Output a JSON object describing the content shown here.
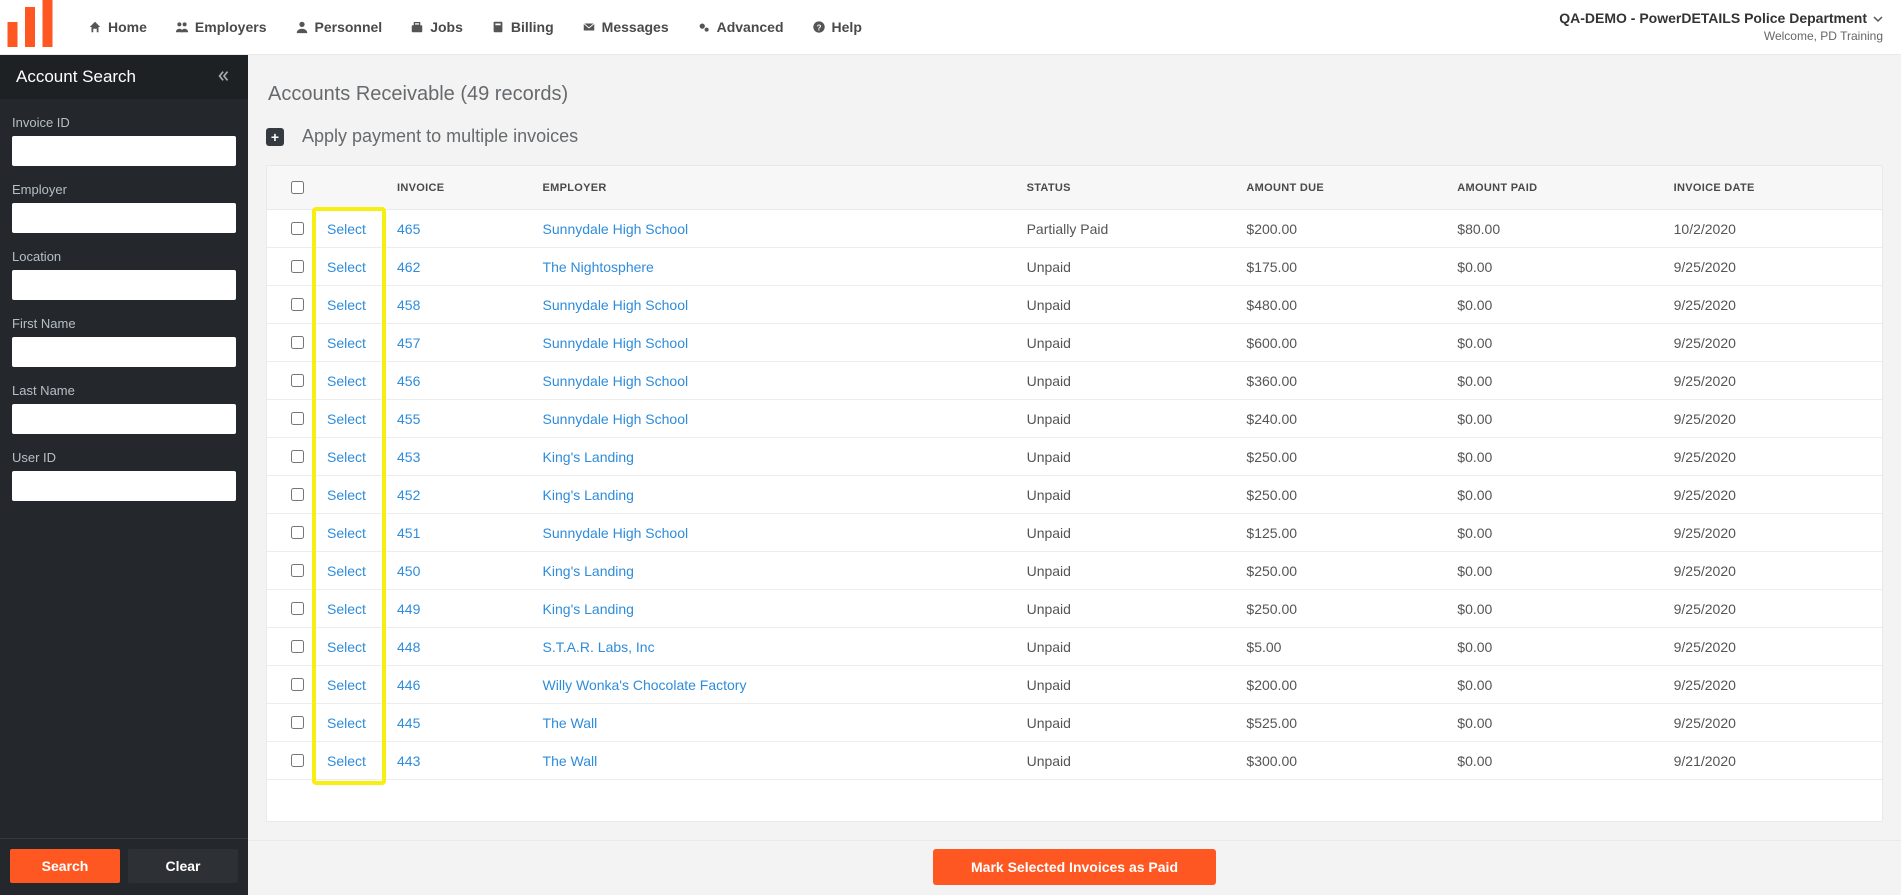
{
  "header": {
    "nav": [
      {
        "label": "Home",
        "icon": "home"
      },
      {
        "label": "Employers",
        "icon": "users"
      },
      {
        "label": "Personnel",
        "icon": "person"
      },
      {
        "label": "Jobs",
        "icon": "briefcase"
      },
      {
        "label": "Billing",
        "icon": "calc"
      },
      {
        "label": "Messages",
        "icon": "envelope"
      },
      {
        "label": "Advanced",
        "icon": "cogs"
      },
      {
        "label": "Help",
        "icon": "question"
      }
    ],
    "org": "QA-DEMO - PowerDETAILS Police Department",
    "welcome": "Welcome, PD Training"
  },
  "sidebar": {
    "title": "Account Search",
    "fields": {
      "invoice_id": {
        "label": "Invoice ID"
      },
      "employer": {
        "label": "Employer"
      },
      "location": {
        "label": "Location"
      },
      "first_name": {
        "label": "First Name"
      },
      "last_name": {
        "label": "Last Name"
      },
      "user_id": {
        "label": "User ID"
      }
    },
    "search_label": "Search",
    "clear_label": "Clear"
  },
  "page": {
    "title": "Accounts Receivable (49 records)",
    "apply_label": "Apply payment to multiple invoices",
    "mark_paid_label": "Mark Selected Invoices as Paid"
  },
  "table": {
    "select_label": "Select",
    "columns": [
      "INVOICE",
      "EMPLOYER",
      "STATUS",
      "AMOUNT DUE",
      "AMOUNT PAID",
      "INVOICE DATE"
    ],
    "rows": [
      {
        "invoice": "465",
        "employer": "Sunnydale High School",
        "status": "Partially Paid",
        "amount_due": "$200.00",
        "amount_paid": "$80.00",
        "date": "10/2/2020"
      },
      {
        "invoice": "462",
        "employer": "The Nightosphere",
        "status": "Unpaid",
        "amount_due": "$175.00",
        "amount_paid": "$0.00",
        "date": "9/25/2020"
      },
      {
        "invoice": "458",
        "employer": "Sunnydale High School",
        "status": "Unpaid",
        "amount_due": "$480.00",
        "amount_paid": "$0.00",
        "date": "9/25/2020"
      },
      {
        "invoice": "457",
        "employer": "Sunnydale High School",
        "status": "Unpaid",
        "amount_due": "$600.00",
        "amount_paid": "$0.00",
        "date": "9/25/2020"
      },
      {
        "invoice": "456",
        "employer": "Sunnydale High School",
        "status": "Unpaid",
        "amount_due": "$360.00",
        "amount_paid": "$0.00",
        "date": "9/25/2020"
      },
      {
        "invoice": "455",
        "employer": "Sunnydale High School",
        "status": "Unpaid",
        "amount_due": "$240.00",
        "amount_paid": "$0.00",
        "date": "9/25/2020"
      },
      {
        "invoice": "453",
        "employer": "King's Landing",
        "status": "Unpaid",
        "amount_due": "$250.00",
        "amount_paid": "$0.00",
        "date": "9/25/2020"
      },
      {
        "invoice": "452",
        "employer": "King's Landing",
        "status": "Unpaid",
        "amount_due": "$250.00",
        "amount_paid": "$0.00",
        "date": "9/25/2020"
      },
      {
        "invoice": "451",
        "employer": "Sunnydale High School",
        "status": "Unpaid",
        "amount_due": "$125.00",
        "amount_paid": "$0.00",
        "date": "9/25/2020"
      },
      {
        "invoice": "450",
        "employer": "King's Landing",
        "status": "Unpaid",
        "amount_due": "$250.00",
        "amount_paid": "$0.00",
        "date": "9/25/2020"
      },
      {
        "invoice": "449",
        "employer": "King's Landing",
        "status": "Unpaid",
        "amount_due": "$250.00",
        "amount_paid": "$0.00",
        "date": "9/25/2020"
      },
      {
        "invoice": "448",
        "employer": "S.T.A.R. Labs, Inc",
        "status": "Unpaid",
        "amount_due": "$5.00",
        "amount_paid": "$0.00",
        "date": "9/25/2020"
      },
      {
        "invoice": "446",
        "employer": "Willy Wonka's Chocolate Factory",
        "status": "Unpaid",
        "amount_due": "$200.00",
        "amount_paid": "$0.00",
        "date": "9/25/2020"
      },
      {
        "invoice": "445",
        "employer": "The Wall",
        "status": "Unpaid",
        "amount_due": "$525.00",
        "amount_paid": "$0.00",
        "date": "9/25/2020"
      },
      {
        "invoice": "443",
        "employer": "The Wall",
        "status": "Unpaid",
        "amount_due": "$300.00",
        "amount_paid": "$0.00",
        "date": "9/21/2020"
      }
    ]
  }
}
